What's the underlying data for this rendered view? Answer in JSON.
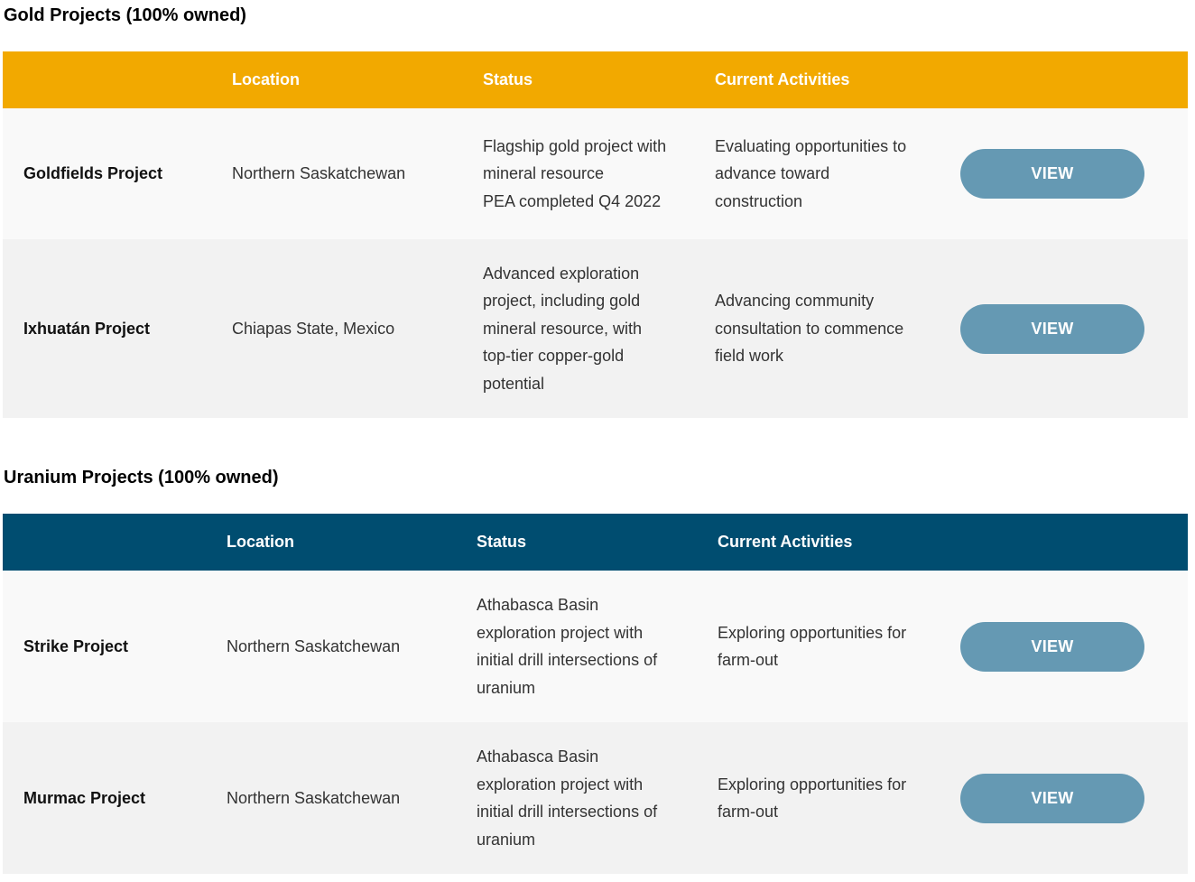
{
  "gold": {
    "title": "Gold Projects (100% owned)",
    "headers": {
      "name": "",
      "location": "Location",
      "status": "Status",
      "activities": "Current Activities",
      "action": ""
    },
    "rows": [
      {
        "name": "Goldfields Project",
        "location": "Northern Saskatchewan",
        "status": [
          "Flagship gold project with",
          "mineral resource",
          "PEA completed Q4 2022"
        ],
        "activities": [
          "Evaluating opportunities to",
          "advance toward",
          "construction"
        ],
        "button": "VIEW"
      },
      {
        "name": "Ixhuatán Project",
        "location": "Chiapas State, Mexico",
        "status": [
          "Advanced exploration",
          "project, including gold",
          "mineral resource, with",
          "top-tier copper-gold",
          "potential"
        ],
        "activities": [
          "Advancing community",
          "consultation to commence",
          "field work"
        ],
        "button": "VIEW"
      }
    ]
  },
  "uranium": {
    "title": "Uranium Projects (100% owned)",
    "headers": {
      "name": "",
      "location": "Location",
      "status": "Status",
      "activities": "Current Activities",
      "action": ""
    },
    "rows": [
      {
        "name": "Strike Project",
        "location": "Northern Saskatchewan",
        "status": [
          "Athabasca Basin",
          "exploration project with",
          "initial drill intersections of",
          "uranium"
        ],
        "activities": [
          "Exploring opportunities for",
          "farm-out"
        ],
        "button": "VIEW"
      },
      {
        "name": "Murmac Project",
        "location": "Northern Saskatchewan",
        "status": [
          "Athabasca Basin",
          "exploration project with",
          "initial drill intersections of",
          "uranium"
        ],
        "activities": [
          "Exploring opportunities for",
          "farm-out"
        ],
        "button": "VIEW"
      }
    ]
  },
  "colors": {
    "gold_header": "#f2a900",
    "uranium_header": "#004d70",
    "view_button": "#6599b3",
    "row_light": "#f9f9f9",
    "row_dark": "#f2f2f2"
  }
}
